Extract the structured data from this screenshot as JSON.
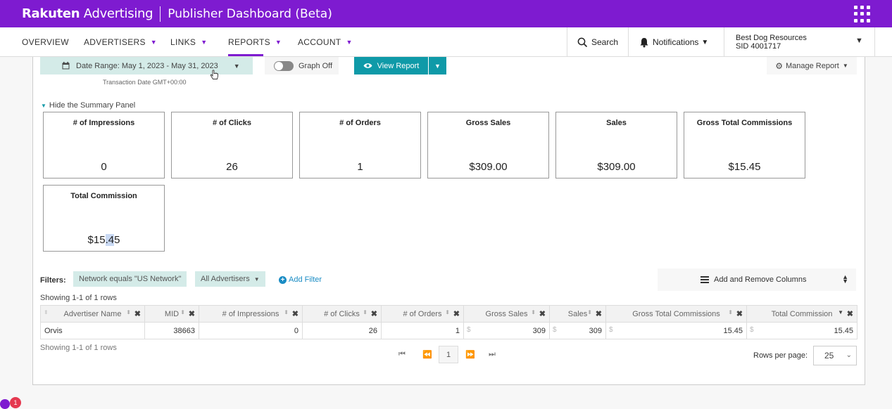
{
  "topbar": {
    "brand_bold": "Rakuten",
    "brand_light": "Advertising",
    "app_title": "Publisher Dashboard (Beta)",
    "bg_color": "#7e1bd0"
  },
  "nav": {
    "items": [
      "OVERVIEW",
      "ADVERTISERS",
      "LINKS",
      "REPORTS",
      "ACCOUNT"
    ],
    "active": "REPORTS",
    "search_label": "Search",
    "notifications_label": "Notifications",
    "account_name": "Best Dog Resources",
    "account_sid": "SID 4001717"
  },
  "toolbar": {
    "date_range": "Date Range: May 1, 2023 - May 31, 2023",
    "tz_note": "Transaction Date GMT+00:00",
    "graph_toggle": "Graph Off",
    "view_report": "View Report",
    "manage_report": "Manage Report"
  },
  "summary": {
    "toggle_label": "Hide the Summary Panel",
    "cards": [
      {
        "label": "# of Impressions",
        "value": "0"
      },
      {
        "label": "# of Clicks",
        "value": "26"
      },
      {
        "label": "# of Orders",
        "value": "1"
      },
      {
        "label": "Gross Sales",
        "value": "$309.00"
      },
      {
        "label": "Sales",
        "value": "$309.00"
      },
      {
        "label": "Gross Total Commissions",
        "value": "$15.45"
      },
      {
        "label": "Total Commission",
        "value_pre": "$15",
        "value_hl": ".4",
        "value_post": "5"
      }
    ]
  },
  "filters": {
    "label": "Filters:",
    "chips": [
      "Network equals \"US Network\"",
      "All Advertisers"
    ],
    "add_filter": "Add Filter",
    "columns_button": "Add and Remove Columns"
  },
  "table": {
    "showing_top": "Showing 1-1 of 1 rows",
    "showing_bottom": "Showing 1-1 of 1 rows",
    "columns": [
      "Advertiser Name",
      "MID",
      "# of Impressions",
      "# of Clicks",
      "# of Orders",
      "Gross Sales",
      "Sales",
      "Gross Total Commissions",
      "Total Commission"
    ],
    "rows": [
      [
        "Orvis",
        "38663",
        "0",
        "26",
        "1",
        "309",
        "309",
        "15.45",
        "15.45"
      ]
    ],
    "currency_symbol": "$"
  },
  "pagination": {
    "current_page": "1",
    "rows_per_page_label": "Rows per page:",
    "rows_per_page": "25"
  },
  "badge": {
    "count": "1"
  }
}
